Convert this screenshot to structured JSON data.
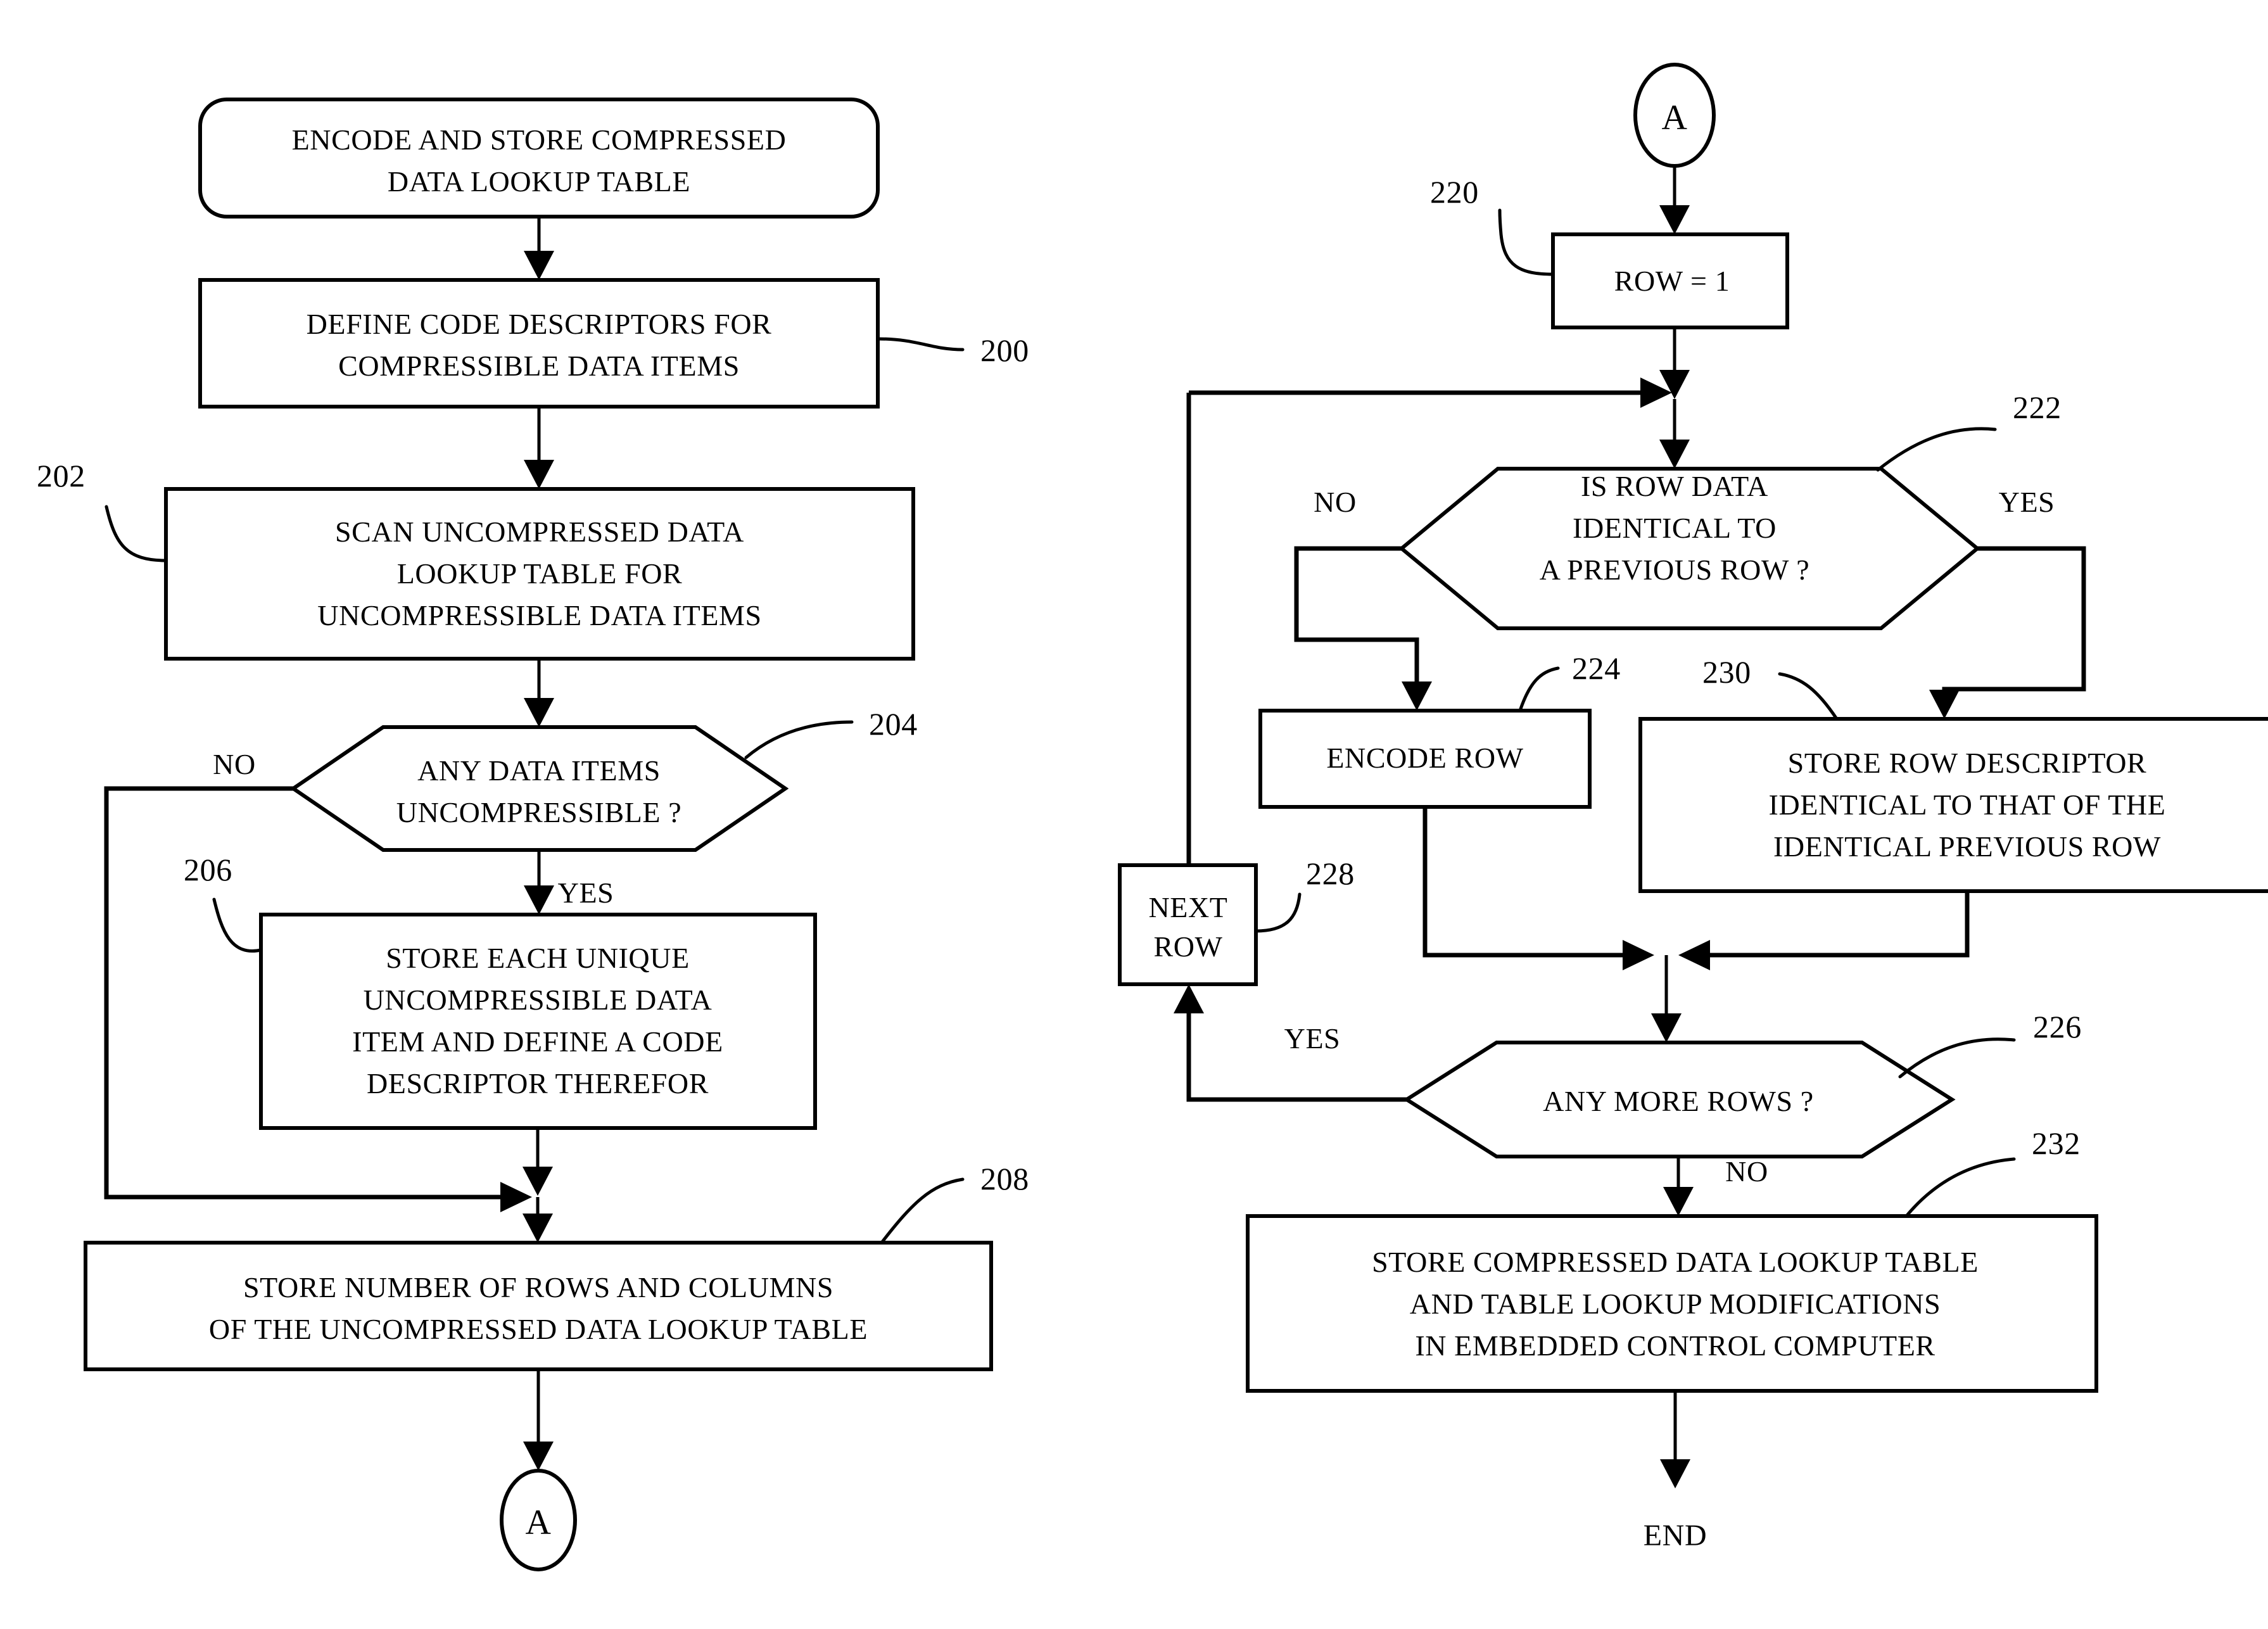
{
  "figure": {
    "type": "flowchart",
    "orientation": "two-column",
    "background_color": "#ffffff",
    "line_color": "#000000"
  },
  "left_column": {
    "start": {
      "id": "start-terminator",
      "shape": "rounded-rectangle",
      "line1": "ENCODE AND STORE COMPRESSED",
      "line2": "DATA LOOKUP TABLE"
    },
    "step_200": {
      "ref": "200",
      "shape": "rectangle",
      "line1": "DEFINE CODE DESCRIPTORS FOR",
      "line2": "COMPRESSIBLE DATA ITEMS"
    },
    "step_202": {
      "ref": "202",
      "shape": "rectangle",
      "line1": "SCAN UNCOMPRESSED DATA",
      "line2": "LOOKUP TABLE FOR",
      "line3": "UNCOMPRESSIBLE DATA ITEMS"
    },
    "decision_204": {
      "ref": "204",
      "shape": "hexagon",
      "line1": "ANY DATA ITEMS",
      "line2": "UNCOMPRESSIBLE ?",
      "branch_no": "NO",
      "branch_yes": "YES"
    },
    "step_206": {
      "ref": "206",
      "shape": "rectangle",
      "line1": "STORE EACH UNIQUE",
      "line2": "UNCOMPRESSIBLE DATA",
      "line3": "ITEM AND DEFINE A CODE",
      "line4": "DESCRIPTOR THEREFOR"
    },
    "step_208": {
      "ref": "208",
      "shape": "rectangle",
      "line1": "STORE NUMBER OF ROWS AND COLUMNS",
      "line2": "OF THE UNCOMPRESSED DATA LOOKUP TABLE"
    },
    "connector_out": {
      "id": "off-page-connector-a-out",
      "shape": "circle",
      "label": "A"
    }
  },
  "right_column": {
    "connector_in": {
      "id": "off-page-connector-a-in",
      "shape": "circle",
      "label": "A"
    },
    "step_220": {
      "ref": "220",
      "shape": "rectangle",
      "line1": "ROW = 1"
    },
    "decision_222": {
      "ref": "222",
      "shape": "hexagon",
      "line1": "IS ROW DATA",
      "line2": "IDENTICAL TO",
      "line3": "A PREVIOUS ROW ?",
      "branch_no": "NO",
      "branch_yes": "YES"
    },
    "step_224": {
      "ref": "224",
      "shape": "rectangle",
      "line1": "ENCODE ROW"
    },
    "step_230": {
      "ref": "230",
      "shape": "rectangle",
      "line1": "STORE ROW DESCRIPTOR",
      "line2": "IDENTICAL TO THAT OF THE",
      "line3": "IDENTICAL PREVIOUS ROW"
    },
    "step_228": {
      "ref": "228",
      "shape": "rectangle",
      "line1": "NEXT",
      "line2": "ROW"
    },
    "decision_226": {
      "ref": "226",
      "shape": "hexagon",
      "line1": "ANY MORE ROWS ?",
      "branch_yes": "YES",
      "branch_no": "NO"
    },
    "step_232": {
      "ref": "232",
      "shape": "rectangle",
      "line1": "STORE COMPRESSED DATA LOOKUP TABLE",
      "line2": "AND TABLE LOOKUP MODIFICATIONS",
      "line3": "IN EMBEDDED CONTROL COMPUTER"
    },
    "end": {
      "id": "end-terminator",
      "label": "END"
    }
  }
}
